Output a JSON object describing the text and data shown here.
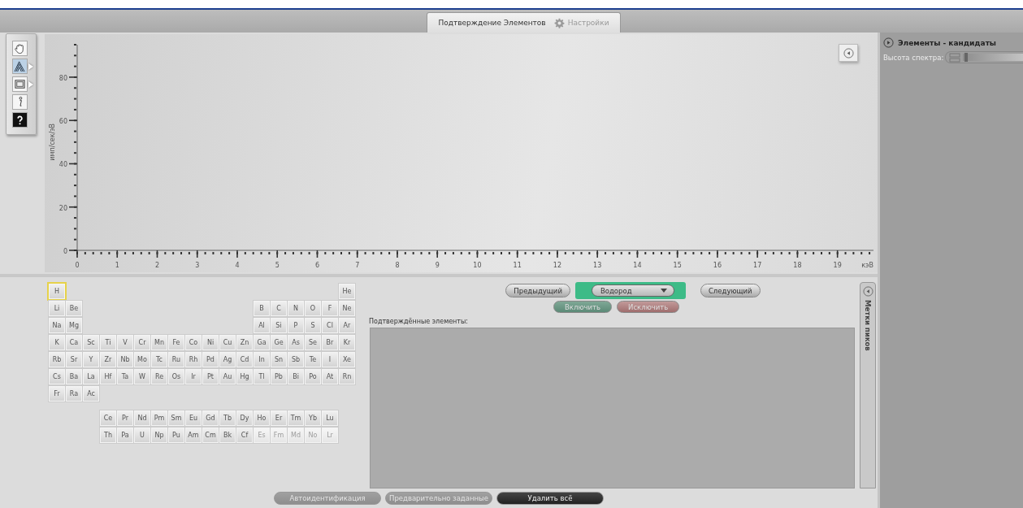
{
  "top_tabs": [
    {
      "label": "Подтверждение Элементов",
      "selected": true
    },
    {
      "label": "Настройки",
      "selected": false
    }
  ],
  "chart": {
    "chart_data": {
      "type": "line",
      "xlabel": "кэВ",
      "ylabel": "имп/сек/эВ",
      "xlim": [
        0,
        19.9
      ],
      "ylim": [
        0,
        95
      ],
      "xticks": [
        0,
        1,
        2,
        3,
        4,
        5,
        6,
        7,
        8,
        9,
        10,
        11,
        12,
        13,
        14,
        15,
        16,
        17,
        18,
        19
      ],
      "yticks": [
        0,
        20,
        40,
        60,
        80
      ]
    }
  },
  "periodic_table": {
    "rows": [
      [
        {
          "symbol": "H",
          "selected": true,
          "disabled": false
        },
        "",
        "",
        "",
        "",
        "",
        "",
        "",
        "",
        "",
        "",
        "",
        "",
        "",
        "",
        "",
        "",
        {
          "symbol": "He",
          "selected": false,
          "disabled": false
        }
      ],
      [
        {
          "symbol": "Li",
          "selected": false,
          "disabled": false
        },
        {
          "symbol": "Be",
          "selected": false,
          "disabled": false
        },
        "",
        "",
        "",
        "",
        "",
        "",
        "",
        "",
        "",
        "",
        {
          "symbol": "B",
          "selected": false,
          "disabled": false
        },
        {
          "symbol": "C",
          "selected": false,
          "disabled": false
        },
        {
          "symbol": "N",
          "selected": false,
          "disabled": false
        },
        {
          "symbol": "O",
          "selected": false,
          "disabled": false
        },
        {
          "symbol": "F",
          "selected": false,
          "disabled": false
        },
        {
          "symbol": "Ne",
          "selected": false,
          "disabled": false
        }
      ],
      [
        {
          "symbol": "Na",
          "selected": false,
          "disabled": false
        },
        {
          "symbol": "Mg",
          "selected": false,
          "disabled": false
        },
        "",
        "",
        "",
        "",
        "",
        "",
        "",
        "",
        "",
        "",
        {
          "symbol": "Al",
          "selected": false,
          "disabled": false
        },
        {
          "symbol": "Si",
          "selected": false,
          "disabled": false
        },
        {
          "symbol": "P",
          "selected": false,
          "disabled": false
        },
        {
          "symbol": "S",
          "selected": false,
          "disabled": false
        },
        {
          "symbol": "Cl",
          "selected": false,
          "disabled": false
        },
        {
          "symbol": "Ar",
          "selected": false,
          "disabled": false
        }
      ],
      [
        {
          "symbol": "K",
          "selected": false,
          "disabled": false
        },
        {
          "symbol": "Ca",
          "selected": false,
          "disabled": false
        },
        {
          "symbol": "Sc",
          "selected": false,
          "disabled": false
        },
        {
          "symbol": "Ti",
          "selected": false,
          "disabled": false
        },
        {
          "symbol": "V",
          "selected": false,
          "disabled": false
        },
        {
          "symbol": "Cr",
          "selected": false,
          "disabled": false
        },
        {
          "symbol": "Mn",
          "selected": false,
          "disabled": false
        },
        {
          "symbol": "Fe",
          "selected": false,
          "disabled": false
        },
        {
          "symbol": "Co",
          "selected": false,
          "disabled": false
        },
        {
          "symbol": "Ni",
          "selected": false,
          "disabled": false
        },
        {
          "symbol": "Cu",
          "selected": false,
          "disabled": false
        },
        {
          "symbol": "Zn",
          "selected": false,
          "disabled": false
        },
        {
          "symbol": "Ga",
          "selected": false,
          "disabled": false
        },
        {
          "symbol": "Ge",
          "selected": false,
          "disabled": false
        },
        {
          "symbol": "As",
          "selected": false,
          "disabled": false
        },
        {
          "symbol": "Se",
          "selected": false,
          "disabled": false
        },
        {
          "symbol": "Br",
          "selected": false,
          "disabled": false
        },
        {
          "symbol": "Kr",
          "selected": false,
          "disabled": false
        }
      ],
      [
        {
          "symbol": "Rb",
          "selected": false,
          "disabled": false
        },
        {
          "symbol": "Sr",
          "selected": false,
          "disabled": false
        },
        {
          "symbol": "Y",
          "selected": false,
          "disabled": false
        },
        {
          "symbol": "Zr",
          "selected": false,
          "disabled": false
        },
        {
          "symbol": "Nb",
          "selected": false,
          "disabled": false
        },
        {
          "symbol": "Mo",
          "selected": false,
          "disabled": false
        },
        {
          "symbol": "Tc",
          "selected": false,
          "disabled": false
        },
        {
          "symbol": "Ru",
          "selected": false,
          "disabled": false
        },
        {
          "symbol": "Rh",
          "selected": false,
          "disabled": false
        },
        {
          "symbol": "Pd",
          "selected": false,
          "disabled": false
        },
        {
          "symbol": "Ag",
          "selected": false,
          "disabled": false
        },
        {
          "symbol": "Cd",
          "selected": false,
          "disabled": false
        },
        {
          "symbol": "In",
          "selected": false,
          "disabled": false
        },
        {
          "symbol": "Sn",
          "selected": false,
          "disabled": false
        },
        {
          "symbol": "Sb",
          "selected": false,
          "disabled": false
        },
        {
          "symbol": "Te",
          "selected": false,
          "disabled": false
        },
        {
          "symbol": "I",
          "selected": false,
          "disabled": false
        },
        {
          "symbol": "Xe",
          "selected": false,
          "disabled": false
        }
      ],
      [
        {
          "symbol": "Cs",
          "selected": false,
          "disabled": false
        },
        {
          "symbol": "Ba",
          "selected": false,
          "disabled": false
        },
        {
          "symbol": "La",
          "selected": false,
          "disabled": false
        },
        {
          "symbol": "Hf",
          "selected": false,
          "disabled": false
        },
        {
          "symbol": "Ta",
          "selected": false,
          "disabled": false
        },
        {
          "symbol": "W",
          "selected": false,
          "disabled": false
        },
        {
          "symbol": "Re",
          "selected": false,
          "disabled": false
        },
        {
          "symbol": "Os",
          "selected": false,
          "disabled": false
        },
        {
          "symbol": "Ir",
          "selected": false,
          "disabled": false
        },
        {
          "symbol": "Pt",
          "selected": false,
          "disabled": false
        },
        {
          "symbol": "Au",
          "selected": false,
          "disabled": false
        },
        {
          "symbol": "Hg",
          "selected": false,
          "disabled": false
        },
        {
          "symbol": "Tl",
          "selected": false,
          "disabled": false
        },
        {
          "symbol": "Pb",
          "selected": false,
          "disabled": false
        },
        {
          "symbol": "Bi",
          "selected": false,
          "disabled": false
        },
        {
          "symbol": "Po",
          "selected": false,
          "disabled": false
        },
        {
          "symbol": "At",
          "selected": false,
          "disabled": false
        },
        {
          "symbol": "Rn",
          "selected": false,
          "disabled": false
        }
      ],
      [
        {
          "symbol": "Fr",
          "selected": false,
          "disabled": false
        },
        {
          "symbol": "Ra",
          "selected": false,
          "disabled": false
        },
        {
          "symbol": "Ac",
          "selected": false,
          "disabled": false
        }
      ],
      [
        "",
        "",
        "",
        {
          "symbol": "Ce",
          "selected": false,
          "disabled": false
        },
        {
          "symbol": "Pr",
          "selected": false,
          "disabled": false
        },
        {
          "symbol": "Nd",
          "selected": false,
          "disabled": false
        },
        {
          "symbol": "Pm",
          "selected": false,
          "disabled": false
        },
        {
          "symbol": "Sm",
          "selected": false,
          "disabled": false
        },
        {
          "symbol": "Eu",
          "selected": false,
          "disabled": false
        },
        {
          "symbol": "Gd",
          "selected": false,
          "disabled": false
        },
        {
          "symbol": "Tb",
          "selected": false,
          "disabled": false
        },
        {
          "symbol": "Dy",
          "selected": false,
          "disabled": false
        },
        {
          "symbol": "Ho",
          "selected": false,
          "disabled": false
        },
        {
          "symbol": "Er",
          "selected": false,
          "disabled": false
        },
        {
          "symbol": "Tm",
          "selected": false,
          "disabled": false
        },
        {
          "symbol": "Yb",
          "selected": false,
          "disabled": false
        },
        {
          "symbol": "Lu",
          "selected": false,
          "disabled": false
        }
      ],
      [
        "",
        "",
        "",
        {
          "symbol": "Th",
          "selected": false,
          "disabled": false
        },
        {
          "symbol": "Pa",
          "selected": false,
          "disabled": false
        },
        {
          "symbol": "U",
          "selected": false,
          "disabled": false
        },
        {
          "symbol": "Np",
          "selected": false,
          "disabled": false
        },
        {
          "symbol": "Pu",
          "selected": false,
          "disabled": false
        },
        {
          "symbol": "Am",
          "selected": false,
          "disabled": false
        },
        {
          "symbol": "Cm",
          "selected": false,
          "disabled": false
        },
        {
          "symbol": "Bk",
          "selected": false,
          "disabled": false
        },
        {
          "symbol": "Cf",
          "selected": false,
          "disabled": false
        },
        {
          "symbol": "Es",
          "selected": false,
          "disabled": true
        },
        {
          "symbol": "Fm",
          "selected": false,
          "disabled": true
        },
        {
          "symbol": "Md",
          "selected": false,
          "disabled": true
        },
        {
          "symbol": "No",
          "selected": false,
          "disabled": true
        },
        {
          "symbol": "Lr",
          "selected": false,
          "disabled": true
        }
      ]
    ]
  },
  "navigation": {
    "previous": "Предыдущий",
    "element_dropdown": "Водород",
    "next": "Следующий",
    "include": "Включить",
    "exclude": "Исключить"
  },
  "confirmed": {
    "label": "Подтверждённые элементы:"
  },
  "peak_labels_tab": "Метки пиков",
  "bottom_buttons": [
    {
      "label": "Автоидентификация",
      "disabled": true
    },
    {
      "label": "Предварительно заданные",
      "disabled": true
    },
    {
      "label": "Удалить всё",
      "disabled": false
    }
  ],
  "candidates_panel": {
    "title": "Элементы - кандидаты",
    "spectrum_height": {
      "label": "Высота спектра:",
      "level": 0.02
    }
  }
}
